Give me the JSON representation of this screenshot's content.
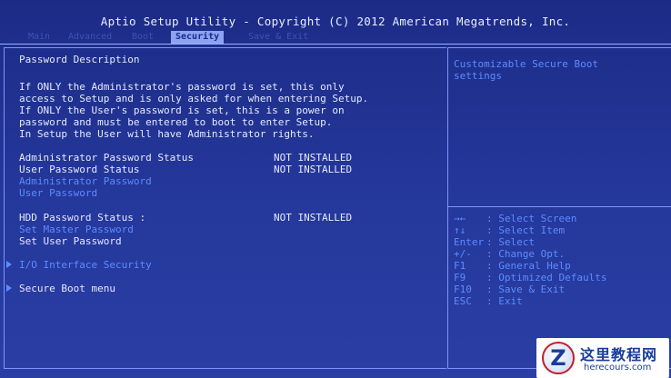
{
  "header": {
    "title": "Aptio Setup Utility - Copyright (C) 2012 American Megatrends, Inc."
  },
  "tabs": [
    {
      "label": "Main"
    },
    {
      "label": "Advanced"
    },
    {
      "label": "Boot"
    },
    {
      "label": "Security",
      "active": true
    },
    {
      "label": "Save & Exit"
    }
  ],
  "description": {
    "heading": "Password Description",
    "lines": [
      "If ONLY the Administrator's password is set, this only",
      "access to Setup and is only asked for when entering Setup.",
      "If ONLY the User's password is set, this is a power on",
      "password and must be entered to boot to enter Setup.",
      "In Setup the User will have Administrator rights."
    ]
  },
  "status": {
    "admin_label": "Administrator Password Status",
    "admin_value": "NOT INSTALLED",
    "user_label": "User Password Status",
    "user_value": "NOT INSTALLED",
    "hdd_label": "HDD Password Status  :",
    "hdd_value": "NOT INSTALLED"
  },
  "options": {
    "admin_password": "Administrator Password",
    "user_password": "User Password",
    "set_master_password": "Set Master Password",
    "set_user_password": "Set User Password",
    "io_interface_security": "I/O Interface Security",
    "secure_boot_menu": "Secure Boot menu"
  },
  "help_text": {
    "line1": "Customizable Secure Boot",
    "line2": "settings"
  },
  "keys": [
    {
      "key": "→←",
      "action": "Select Screen"
    },
    {
      "key": "↑↓",
      "action": "Select Item"
    },
    {
      "key": "Enter",
      "action": "Select"
    },
    {
      "key": "+/-",
      "action": "Change Opt."
    },
    {
      "key": "F1",
      "action": "General Help"
    },
    {
      "key": "F9",
      "action": "Optimized Defaults"
    },
    {
      "key": "F10",
      "action": "Save & Exit"
    },
    {
      "key": "ESC",
      "action": "Exit"
    }
  ],
  "watermark": {
    "logo_letter": "Z",
    "cn": "这里教程网",
    "url": "herecours.com"
  },
  "colors": {
    "background": "#25389c",
    "text_white": "#e6eaff",
    "text_blue": "#5c8cff",
    "active_tab": "#8da2f0"
  }
}
